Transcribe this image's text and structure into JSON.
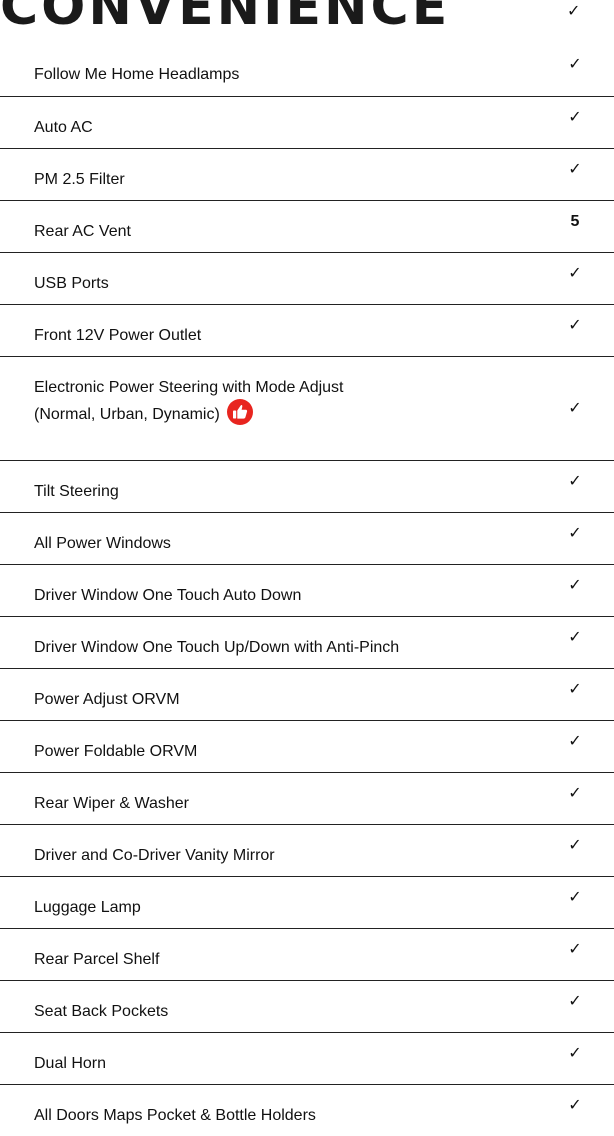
{
  "section": {
    "title": "CONVENIENCE",
    "title_value": "✓"
  },
  "features": [
    {
      "label": "Follow Me Home Headlamps",
      "value": "✓"
    },
    {
      "label": "Auto AC",
      "value": "✓"
    },
    {
      "label": "PM 2.5 Filter",
      "value": "✓"
    },
    {
      "label": "Rear AC Vent",
      "value": "5"
    },
    {
      "label": "USB Ports",
      "value": "✓"
    },
    {
      "label": "Front 12V Power Outlet",
      "value": "✓"
    },
    {
      "label_line1": "Electronic Power Steering with Mode Adjust",
      "label_line2": "(Normal, Urban, Dynamic)",
      "value": "✓",
      "badge_icon": "thumbs-up-icon",
      "badge_color": "#e8251f"
    },
    {
      "label": "Tilt Steering",
      "value": "✓"
    },
    {
      "label": "All Power Windows",
      "value": "✓"
    },
    {
      "label": "Driver Window One Touch Auto Down",
      "value": "✓"
    },
    {
      "label": "Driver Window One Touch Up/Down with Anti-Pinch",
      "value": "✓"
    },
    {
      "label": "Power Adjust ORVM",
      "value": "✓"
    },
    {
      "label": "Power Foldable ORVM",
      "value": "✓"
    },
    {
      "label": "Rear Wiper & Washer",
      "value": "✓"
    },
    {
      "label": "Driver and Co-Driver Vanity Mirror",
      "value": "✓"
    },
    {
      "label": "Luggage Lamp",
      "value": "✓"
    },
    {
      "label": "Rear Parcel Shelf",
      "value": "✓"
    },
    {
      "label": "Seat Back Pockets",
      "value": "✓"
    },
    {
      "label": "Dual Horn",
      "value": "✓"
    },
    {
      "label": "All Doors Maps Pocket & Bottle Holders",
      "value": "✓"
    }
  ],
  "colors": {
    "text": "#111111",
    "divider": "#222222",
    "badge": "#e8251f"
  }
}
